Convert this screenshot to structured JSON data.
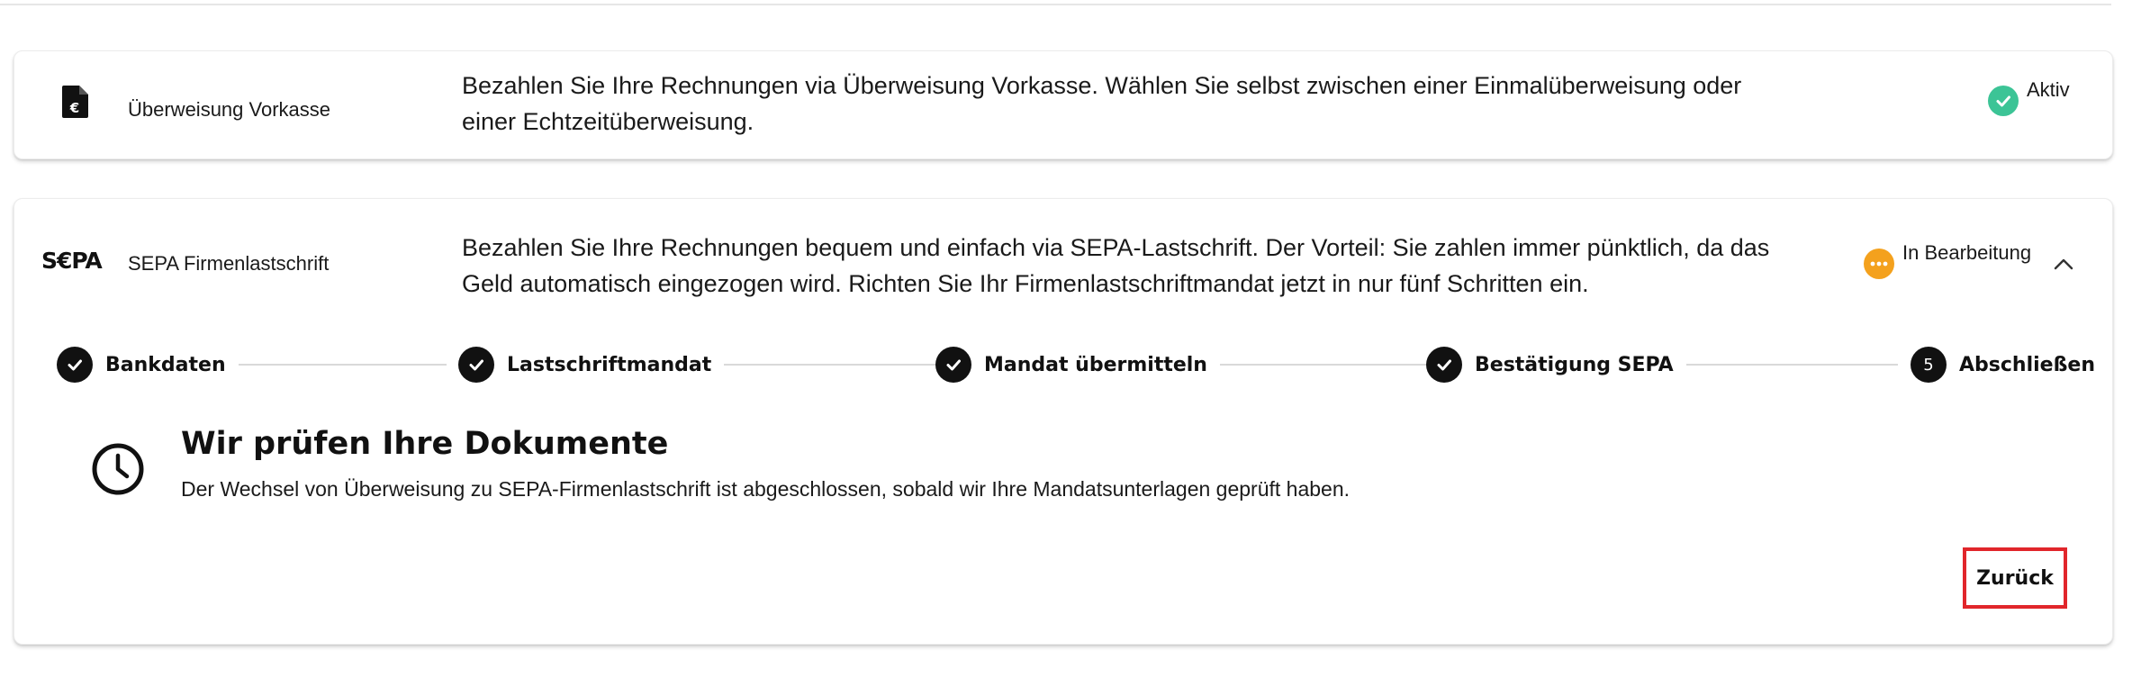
{
  "colors": {
    "active_status": "#3cc496",
    "pending_status": "#f4a11d",
    "step_done": "#111111",
    "highlight_border": "#e1262b"
  },
  "payment_methods": [
    {
      "icon": "euro-invoice-icon",
      "name": "Überweisung Vorkasse",
      "description": "Bezahlen Sie Ihre Rechnungen via Überweisung Vorkasse. Wählen Sie selbst zwischen einer Einmalüberweisung oder einer Echtzeitüberweisung.",
      "status": "Aktiv",
      "status_icon": "check-circle-icon"
    },
    {
      "icon": "sepa-logo",
      "logo_text": "S€PA",
      "name": "SEPA Firmenlastschrift",
      "description": "Bezahlen Sie Ihre Rechnungen bequem und einfach via SEPA-Lastschrift. Der Vorteil: Sie zahlen immer pünktlich, da das Geld automatisch eingezogen wird. Richten Sie Ihr Firmenlastschriftmandat jetzt in nur fünf Schritten ein.",
      "status": "In Bearbeitung",
      "status_icon": "more-horizontal-icon",
      "expanded": true
    }
  ],
  "stepper": {
    "steps": [
      {
        "label": "Bankdaten",
        "state": "done",
        "icon": "check-icon"
      },
      {
        "label": "Lastschriftmandat",
        "state": "done",
        "icon": "check-icon"
      },
      {
        "label": "Mandat übermitteln",
        "state": "done",
        "icon": "check-icon"
      },
      {
        "label": "Bestätigung SEPA",
        "state": "done",
        "icon": "check-icon"
      },
      {
        "label": "Abschließen",
        "state": "current",
        "number": "5"
      }
    ]
  },
  "review": {
    "icon": "clock-icon",
    "title": "Wir prüfen Ihre Dokumente",
    "text": "Der Wechsel von Überweisung zu SEPA-Firmenlastschrift ist abgeschlossen, sobald wir Ihre Mandatsunterlagen geprüft haben."
  },
  "actions": {
    "back_label": "Zurück"
  }
}
